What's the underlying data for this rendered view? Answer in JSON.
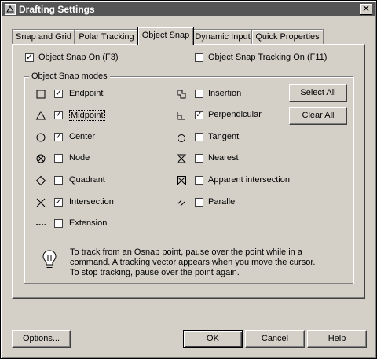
{
  "window": {
    "title": "Drafting Settings",
    "close_glyph": "✕"
  },
  "tabs": [
    {
      "label": "Snap and Grid"
    },
    {
      "label": "Polar Tracking"
    },
    {
      "label": "Object Snap",
      "active": true
    },
    {
      "label": "Dynamic Input"
    },
    {
      "label": "Quick Properties"
    }
  ],
  "object_snap": {
    "snap_on": {
      "label": "Object Snap On (F3)",
      "checked": true
    },
    "tracking_on": {
      "label": "Object Snap Tracking On (F11)",
      "checked": false
    },
    "group_title": "Object Snap modes",
    "modes_left": [
      {
        "label": "Endpoint",
        "checked": true,
        "icon": "endpoint-icon"
      },
      {
        "label": "Midpoint",
        "checked": true,
        "icon": "midpoint-icon"
      },
      {
        "label": "Center",
        "checked": true,
        "icon": "center-icon"
      },
      {
        "label": "Node",
        "checked": false,
        "icon": "node-icon"
      },
      {
        "label": "Quadrant",
        "checked": false,
        "icon": "quadrant-icon"
      },
      {
        "label": "Intersection",
        "checked": true,
        "icon": "intersection-icon"
      },
      {
        "label": "Extension",
        "checked": false,
        "icon": "extension-icon"
      }
    ],
    "modes_right": [
      {
        "label": "Insertion",
        "checked": false,
        "icon": "insertion-icon"
      },
      {
        "label": "Perpendicular",
        "checked": true,
        "icon": "perpendicular-icon"
      },
      {
        "label": "Tangent",
        "checked": false,
        "icon": "tangent-icon"
      },
      {
        "label": "Nearest",
        "checked": false,
        "icon": "nearest-icon"
      },
      {
        "label": "Apparent intersection",
        "checked": false,
        "icon": "apparent-intersection-icon"
      },
      {
        "label": "Parallel",
        "checked": false,
        "icon": "parallel-icon"
      }
    ],
    "select_all_label": "Select All",
    "clear_all_label": "Clear All",
    "tip_lines": [
      "To track from an Osnap point, pause over the point while in a",
      "command.  A tracking vector appears when you move the cursor.",
      "To stop tracking, pause over the point again."
    ]
  },
  "footer": {
    "options_label": "Options...",
    "ok_label": "OK",
    "cancel_label": "Cancel",
    "help_label": "Help"
  },
  "colors": {
    "face": "#d4d0c8",
    "titlebar": "#555555"
  }
}
